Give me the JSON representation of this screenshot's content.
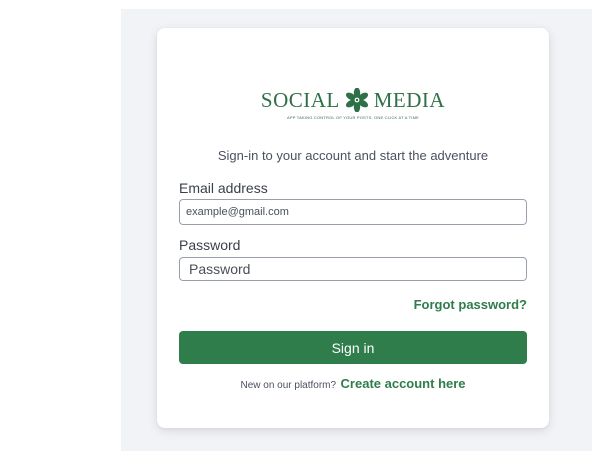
{
  "brand": {
    "name_left": "SOCIAL",
    "name_right": "MEDIA",
    "tagline": "APP TAKING CONTROL OF YOUR POSTS, ONE CLICK AT A TIME",
    "logo_icon": "leaf-flower-icon",
    "color": "#2e7048"
  },
  "login": {
    "subtitle": "Sign-in to your account and start the adventure",
    "email_label": "Email address",
    "email_placeholder": "example@gmail.com",
    "password_label": "Password",
    "password_placeholder": "Password",
    "forgot_label": "Forgot password?",
    "signin_label": "Sign in",
    "new_text": "New on our platform?",
    "create_label": "Create account here"
  },
  "colors": {
    "accent": "#2e7d4a",
    "page_bg": "#f2f3f6",
    "card_bg": "#ffffff"
  }
}
